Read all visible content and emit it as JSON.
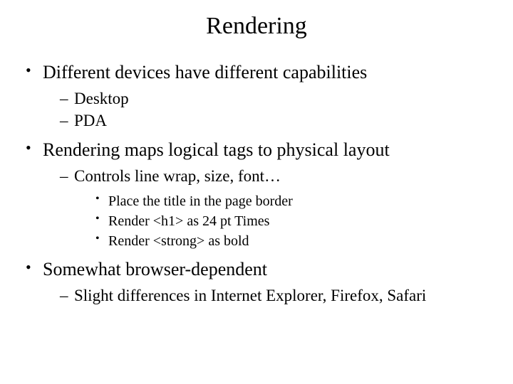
{
  "title": "Rendering",
  "bullets": [
    {
      "text": "Different devices have different capabilities",
      "sub": [
        {
          "text": "Desktop"
        },
        {
          "text": "PDA"
        }
      ]
    },
    {
      "text": "Rendering maps logical tags to physical layout",
      "sub": [
        {
          "text": "Controls line wrap, size, font…",
          "sub": [
            {
              "text": "Place the title in the page border"
            },
            {
              "text": "Render <h1> as 24 pt Times"
            },
            {
              "text": "Render <strong> as bold"
            }
          ]
        }
      ]
    },
    {
      "text": "Somewhat browser-dependent",
      "sub": [
        {
          "text": "Slight differences in Internet Explorer, Firefox, Safari"
        }
      ]
    }
  ]
}
